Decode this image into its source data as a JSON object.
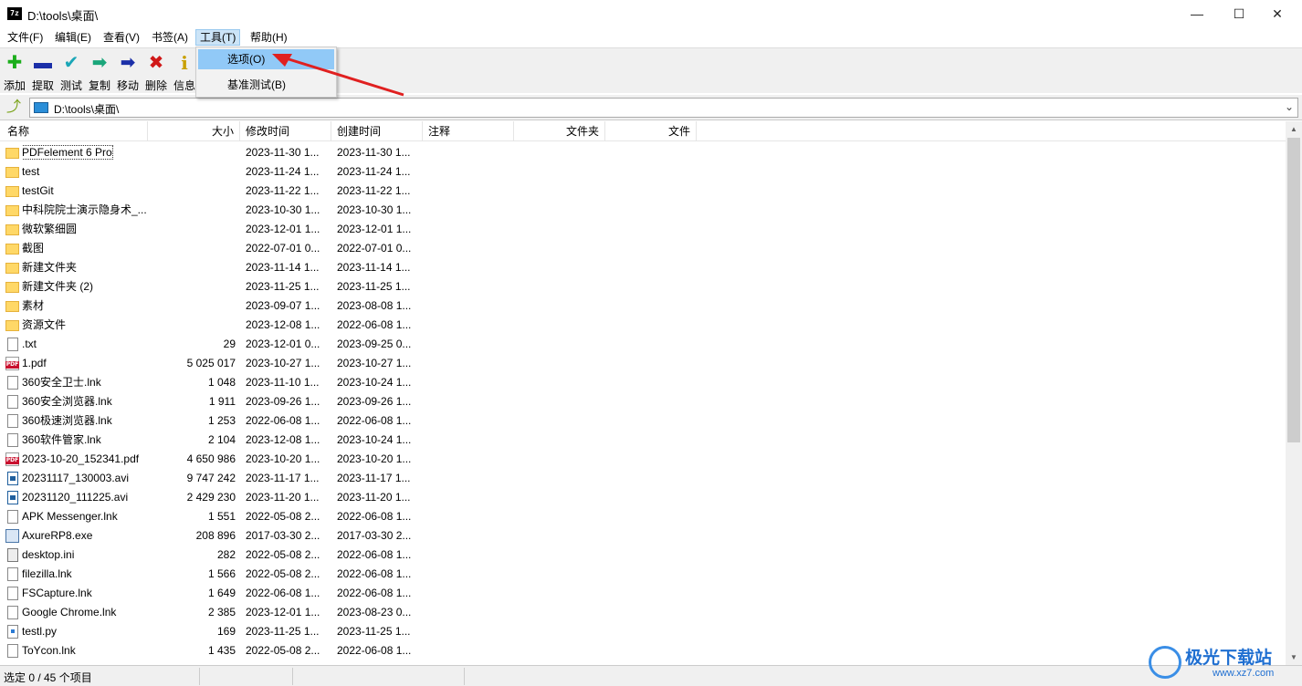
{
  "window": {
    "title": "D:\\tools\\桌面\\",
    "app_icon_text": "7z",
    "minimize": "—",
    "maximize": "☐",
    "close": "✕"
  },
  "menubar": [
    {
      "label": "文件(F)"
    },
    {
      "label": "编辑(E)"
    },
    {
      "label": "查看(V)"
    },
    {
      "label": "书签(A)"
    },
    {
      "label": "工具(T)",
      "active": true
    },
    {
      "label": "帮助(H)"
    }
  ],
  "toolbar": [
    {
      "label": "添加",
      "icon": "plus-icon",
      "glyph": "✚",
      "color": "#1cae1c"
    },
    {
      "label": "提取",
      "icon": "minus-icon",
      "glyph": "▬",
      "color": "#1b2fa8"
    },
    {
      "label": "测试",
      "icon": "check-icon",
      "glyph": "✔",
      "color": "#1aa6b7"
    },
    {
      "label": "复制",
      "icon": "copy-arrow-icon",
      "glyph": "➡",
      "color": "#1aa67a"
    },
    {
      "label": "移动",
      "icon": "move-arrow-icon",
      "glyph": "➡",
      "color": "#1b2fa8"
    },
    {
      "label": "删除",
      "icon": "delete-x-icon",
      "glyph": "✖",
      "color": "#d01818"
    },
    {
      "label": "信息",
      "icon": "info-icon",
      "glyph": "i",
      "color": "#c9a000"
    }
  ],
  "tools_menu": {
    "items": [
      {
        "label": "选项(O)",
        "highlighted": true
      },
      {
        "label": "基准测试(B)",
        "highlighted": false
      }
    ]
  },
  "address": {
    "path": "D:\\tools\\桌面\\",
    "up_glyph": "⤴",
    "chevron": "⌄"
  },
  "columns": {
    "name": "名称",
    "size": "大小",
    "modified": "修改时间",
    "created": "创建时间",
    "comment": "注释",
    "folders": "文件夹",
    "files": "文件"
  },
  "files": [
    {
      "name": "PDFelement 6 Pro",
      "size": "",
      "modified": "2023-11-30 1...",
      "created": "2023-11-30 1...",
      "icon": "folder"
    },
    {
      "name": "test",
      "size": "",
      "modified": "2023-11-24 1...",
      "created": "2023-11-24 1...",
      "icon": "folder"
    },
    {
      "name": "testGit",
      "size": "",
      "modified": "2023-11-22 1...",
      "created": "2023-11-22 1...",
      "icon": "folder"
    },
    {
      "name": "中科院院士演示隐身术_...",
      "size": "",
      "modified": "2023-10-30 1...",
      "created": "2023-10-30 1...",
      "icon": "folder"
    },
    {
      "name": "微软繁细圆",
      "size": "",
      "modified": "2023-12-01 1...",
      "created": "2023-12-01 1...",
      "icon": "folder"
    },
    {
      "name": "截图",
      "size": "",
      "modified": "2022-07-01 0...",
      "created": "2022-07-01 0...",
      "icon": "folder"
    },
    {
      "name": "新建文件夹",
      "size": "",
      "modified": "2023-11-14 1...",
      "created": "2023-11-14 1...",
      "icon": "folder"
    },
    {
      "name": "新建文件夹 (2)",
      "size": "",
      "modified": "2023-11-25 1...",
      "created": "2023-11-25 1...",
      "icon": "folder"
    },
    {
      "name": "素材",
      "size": "",
      "modified": "2023-09-07 1...",
      "created": "2023-08-08 1...",
      "icon": "folder"
    },
    {
      "name": "资源文件",
      "size": "",
      "modified": "2023-12-08 1...",
      "created": "2022-06-08 1...",
      "icon": "folder"
    },
    {
      "name": ".txt",
      "size": "29",
      "modified": "2023-12-01 0...",
      "created": "2023-09-25 0...",
      "icon": "doc"
    },
    {
      "name": "1.pdf",
      "size": "5 025 017",
      "modified": "2023-10-27 1...",
      "created": "2023-10-27 1...",
      "icon": "pdf"
    },
    {
      "name": "360安全卫士.lnk",
      "size": "1 048",
      "modified": "2023-11-10 1...",
      "created": "2023-10-24 1...",
      "icon": "doc"
    },
    {
      "name": "360安全浏览器.lnk",
      "size": "1 911",
      "modified": "2023-09-26 1...",
      "created": "2023-09-26 1...",
      "icon": "doc"
    },
    {
      "name": "360极速浏览器.lnk",
      "size": "1 253",
      "modified": "2022-06-08 1...",
      "created": "2022-06-08 1...",
      "icon": "doc"
    },
    {
      "name": "360软件管家.lnk",
      "size": "2 104",
      "modified": "2023-12-08 1...",
      "created": "2023-10-24 1...",
      "icon": "doc"
    },
    {
      "name": "2023-10-20_152341.pdf",
      "size": "4 650 986",
      "modified": "2023-10-20 1...",
      "created": "2023-10-20 1...",
      "icon": "pdf"
    },
    {
      "name": "20231117_130003.avi",
      "size": "9 747 242",
      "modified": "2023-11-17 1...",
      "created": "2023-11-17 1...",
      "icon": "video"
    },
    {
      "name": "20231120_111225.avi",
      "size": "2 429 230",
      "modified": "2023-11-20 1...",
      "created": "2023-11-20 1...",
      "icon": "video"
    },
    {
      "name": "APK Messenger.lnk",
      "size": "1 551",
      "modified": "2022-05-08 2...",
      "created": "2022-06-08 1...",
      "icon": "doc"
    },
    {
      "name": "AxureRP8.exe",
      "size": "208 896",
      "modified": "2017-03-30 2...",
      "created": "2017-03-30 2...",
      "icon": "exe"
    },
    {
      "name": "desktop.ini",
      "size": "282",
      "modified": "2022-05-08 2...",
      "created": "2022-06-08 1...",
      "icon": "ini"
    },
    {
      "name": "filezilla.lnk",
      "size": "1 566",
      "modified": "2022-05-08 2...",
      "created": "2022-06-08 1...",
      "icon": "doc"
    },
    {
      "name": "FSCapture.lnk",
      "size": "1 649",
      "modified": "2022-06-08 1...",
      "created": "2022-06-08 1...",
      "icon": "doc"
    },
    {
      "name": "Google Chrome.lnk",
      "size": "2 385",
      "modified": "2023-12-01 1...",
      "created": "2023-08-23 0...",
      "icon": "doc"
    },
    {
      "name": "testl.py",
      "size": "169",
      "modified": "2023-11-25 1...",
      "created": "2023-11-25 1...",
      "icon": "py"
    },
    {
      "name": "ToYcon.lnk",
      "size": "1 435",
      "modified": "2022-05-08 2...",
      "created": "2022-06-08 1...",
      "icon": "doc"
    }
  ],
  "status": {
    "selection": "选定 0 / 45 个项目"
  },
  "watermark": {
    "title": "极光下载站",
    "url": "www.xz7.com"
  },
  "colors": {
    "menu_highlight": "#91c9f7",
    "arrow": "#e02020"
  }
}
